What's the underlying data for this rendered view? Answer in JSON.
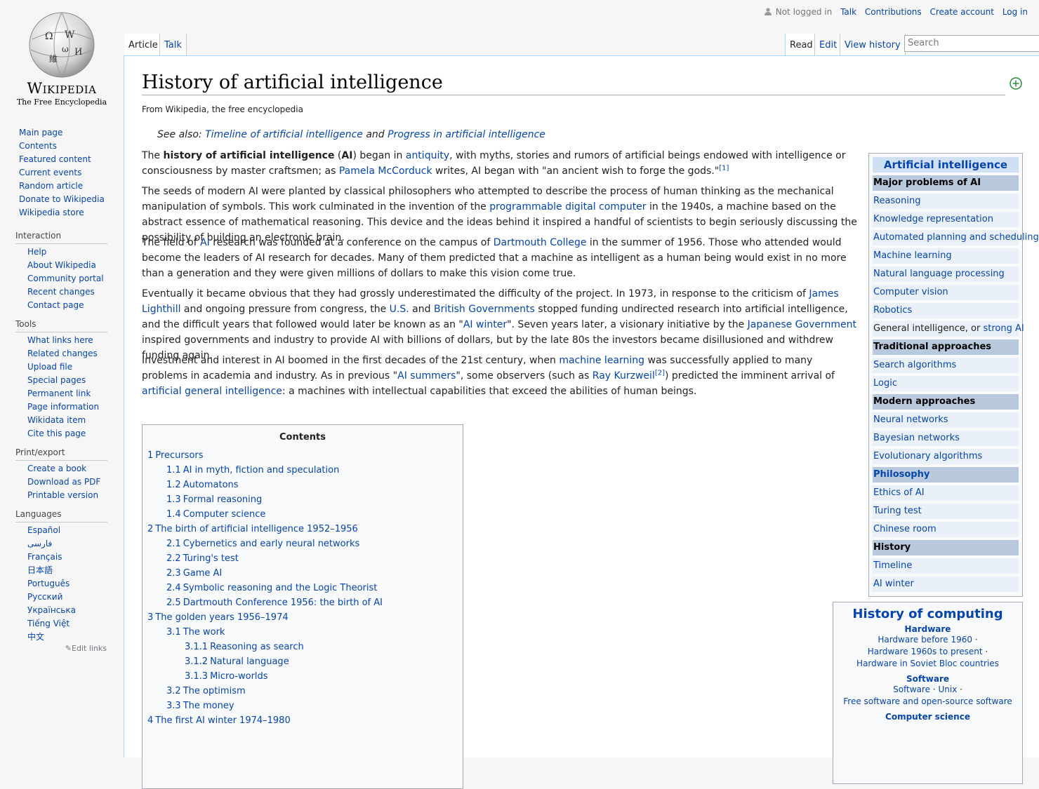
{
  "logo": {
    "wordmark": "Wikipedia",
    "tagline": "The Free Encyclopedia"
  },
  "personal": {
    "not_logged": "Not logged in",
    "talk": "Talk",
    "contributions": "Contributions",
    "create_account": "Create account",
    "log_in": "Log in"
  },
  "tabs": {
    "article": "Article",
    "talk": "Talk",
    "read": "Read",
    "edit": "Edit",
    "view_history": "View history"
  },
  "search": {
    "placeholder": "Search"
  },
  "sidebar": {
    "main": [
      "Main page",
      "Contents",
      "Featured content",
      "Current events",
      "Random article",
      "Donate to Wikipedia",
      "Wikipedia store"
    ],
    "interaction": {
      "heading": "Interaction",
      "items": [
        "Help",
        "About Wikipedia",
        "Community portal",
        "Recent changes",
        "Contact page"
      ]
    },
    "tools": {
      "heading": "Tools",
      "items": [
        "What links here",
        "Related changes",
        "Upload file",
        "Special pages",
        "Permanent link",
        "Page information",
        "Wikidata item",
        "Cite this page"
      ]
    },
    "print": {
      "heading": "Print/export",
      "items": [
        "Create a book",
        "Download as PDF",
        "Printable version"
      ]
    },
    "languages": {
      "heading": "Languages",
      "items": [
        "Español",
        "فارسی",
        "Français",
        "日本語",
        "Português",
        "Русский",
        "Українська",
        "Tiếng Việt",
        "中文"
      ]
    },
    "edit_links": "Edit links"
  },
  "article": {
    "title": "History of artificial intelligence",
    "site_sub": "From Wikipedia, the free encyclopedia",
    "hatnote": {
      "prefix": "See also: ",
      "link1": "Timeline of artificial intelligence",
      "and": " and ",
      "link2": "Progress in artificial intelligence"
    }
  },
  "toc": {
    "title": "Contents",
    "items": [
      {
        "num": "1",
        "text": "Precursors",
        "level": 1
      },
      {
        "num": "1.1",
        "text": "AI in myth, fiction and speculation",
        "level": 2
      },
      {
        "num": "1.2",
        "text": "Automatons",
        "level": 2
      },
      {
        "num": "1.3",
        "text": "Formal reasoning",
        "level": 2
      },
      {
        "num": "1.4",
        "text": "Computer science",
        "level": 2
      },
      {
        "num": "2",
        "text": "The birth of artificial intelligence 1952–1956",
        "level": 1
      },
      {
        "num": "2.1",
        "text": "Cybernetics and early neural networks",
        "level": 2
      },
      {
        "num": "2.2",
        "text": "Turing's test",
        "level": 2
      },
      {
        "num": "2.3",
        "text": "Game AI",
        "level": 2
      },
      {
        "num": "2.4",
        "text": "Symbolic reasoning and the Logic Theorist",
        "level": 2
      },
      {
        "num": "2.5",
        "text": "Dartmouth Conference 1956: the birth of AI",
        "level": 2
      },
      {
        "num": "3",
        "text": "The golden years 1956–1974",
        "level": 1
      },
      {
        "num": "3.1",
        "text": "The work",
        "level": 2
      },
      {
        "num": "3.1.1",
        "text": "Reasoning as search",
        "level": 3
      },
      {
        "num": "3.1.2",
        "text": "Natural language",
        "level": 3
      },
      {
        "num": "3.1.3",
        "text": "Micro-worlds",
        "level": 3
      },
      {
        "num": "3.2",
        "text": "The optimism",
        "level": 2
      },
      {
        "num": "3.3",
        "text": "The money",
        "level": 2
      },
      {
        "num": "4",
        "text": "The first AI winter 1974–1980",
        "level": 1
      }
    ]
  },
  "ai_box": {
    "title": "Artificial intelligence",
    "rows": [
      {
        "text": "Major problems of AI",
        "type": "head"
      },
      {
        "text": "Reasoning",
        "type": "item"
      },
      {
        "text": "Knowledge representation",
        "type": "item"
      },
      {
        "text": "Automated planning and scheduling",
        "type": "item"
      },
      {
        "text": "Machine learning",
        "type": "item"
      },
      {
        "text": "Natural language processing",
        "type": "item"
      },
      {
        "text": "Computer vision",
        "type": "item"
      },
      {
        "text": "Robotics",
        "type": "item"
      },
      {
        "text": "General intelligence, or ",
        "type": "mixed",
        "link": "strong AI"
      },
      {
        "text": "Traditional approaches",
        "type": "head"
      },
      {
        "text": "Search algorithms",
        "type": "item"
      },
      {
        "text": "Logic",
        "type": "item"
      },
      {
        "text": "Modern approaches",
        "type": "head"
      },
      {
        "text": "Neural networks",
        "type": "item"
      },
      {
        "text": "Bayesian networks",
        "type": "item"
      },
      {
        "text": "Evolutionary algorithms",
        "type": "item"
      },
      {
        "text": "Philosophy",
        "type": "headlink"
      },
      {
        "text": "Ethics of AI",
        "type": "item"
      },
      {
        "text": "Turing test",
        "type": "item"
      },
      {
        "text": "Chinese room",
        "type": "item"
      },
      {
        "text": "History",
        "type": "head"
      },
      {
        "text": "Timeline",
        "type": "item"
      },
      {
        "text": "AI winter",
        "type": "item"
      }
    ]
  },
  "hoc_box": {
    "title": "History of computing",
    "hardware": "Hardware",
    "hw_items": [
      "Hardware before 1960",
      "Hardware 1960s to present",
      "Hardware in Soviet Bloc countries"
    ],
    "software": "Software",
    "sw_line1": [
      "Software",
      "Unix"
    ],
    "sw_line2": "Free software and open-source software",
    "cs": "Computer science"
  },
  "colors": {
    "link": "#0645ad",
    "border": "#a7d7f9",
    "box_header": "#b8c9dd",
    "box_title": "#cee0f2"
  }
}
